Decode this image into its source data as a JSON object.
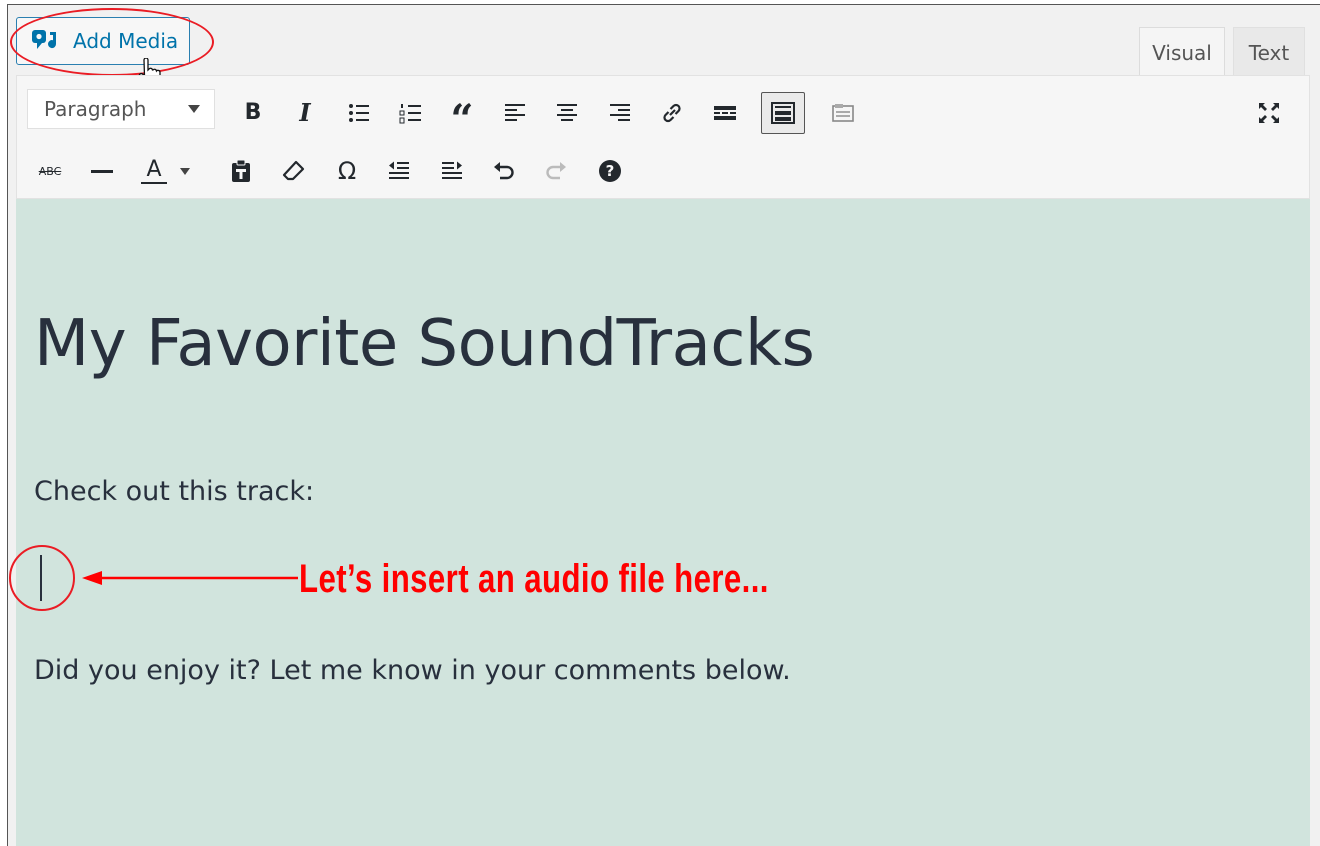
{
  "add_media": {
    "label": "Add Media"
  },
  "tabs": [
    {
      "label": "Visual",
      "active": true
    },
    {
      "label": "Text",
      "active": false
    }
  ],
  "toolbar": {
    "format_select": {
      "value": "Paragraph"
    },
    "row1_icons": [
      "bold-icon",
      "italic-icon",
      "bullet-list-icon",
      "numbered-list-icon",
      "blockquote-icon",
      "align-left-icon",
      "align-center-icon",
      "align-right-icon",
      "link-icon",
      "read-more-icon",
      "toolbar-toggle-icon",
      "content-fields-icon",
      "fullscreen-icon"
    ],
    "row2_icons": [
      "strikethrough-icon",
      "horizontal-line-icon",
      "text-color-icon",
      "paste-text-icon",
      "clear-formatting-icon",
      "special-character-icon",
      "outdent-icon",
      "indent-icon",
      "undo-icon",
      "redo-icon",
      "help-icon"
    ],
    "bold_glyph": "B",
    "italic_glyph": "I",
    "blockquote_glyph": "“",
    "strike_glyph": "ABC",
    "textcolor_glyph": "A",
    "omega_glyph": "Ω",
    "help_glyph": "?"
  },
  "editor": {
    "heading": "My Favorite SoundTracks",
    "paragraph_1": "Check out this track:",
    "paragraph_2": "Did you enjoy it? Let me know in your comments below."
  },
  "annotation": {
    "text": "Let’s insert an audio file here...",
    "color": "#ff0000"
  },
  "colors": {
    "editor_background": "#d1e4dd",
    "link_blue": "#0073aa",
    "annotation_red": "#ea1c24"
  }
}
